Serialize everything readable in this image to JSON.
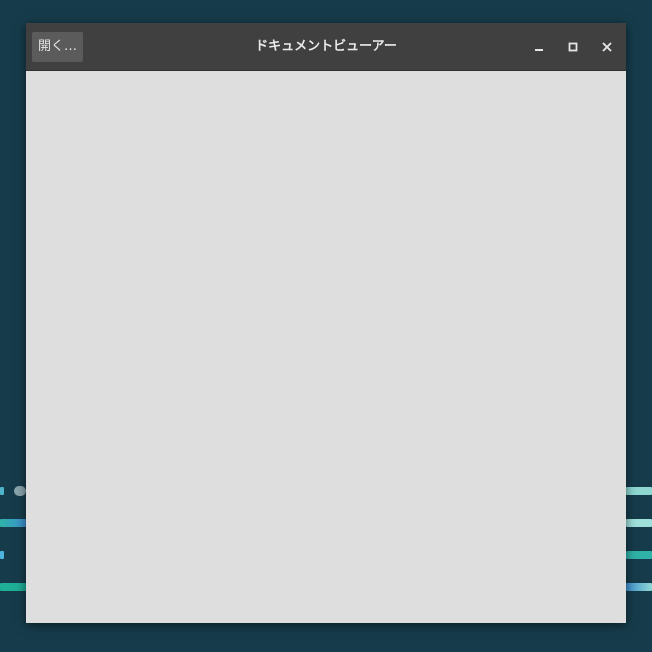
{
  "window": {
    "title": "ドキュメントビューアー",
    "open_button_label": "開く…",
    "controls": {
      "minimize_icon": "minimize-icon",
      "maximize_icon": "maximize-icon",
      "close_icon": "close-icon"
    }
  },
  "colors": {
    "desktop_background": "#163c4b",
    "titlebar": "#404040",
    "open_button": "#5b5b5b",
    "content_background": "#dedede",
    "title_text": "#e9e9e9"
  }
}
